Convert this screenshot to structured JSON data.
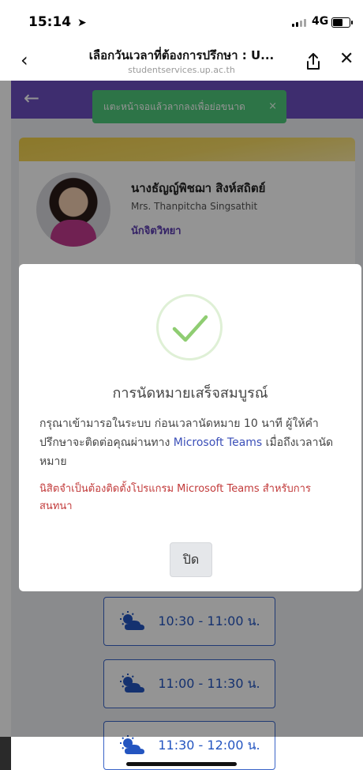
{
  "status_bar": {
    "time": "15:14",
    "location_arrow": "➤",
    "network": "4G"
  },
  "browser": {
    "title": "เลือกวันเวลาที่ต้องการปรึกษา : U...",
    "url": "studentservices.up.ac.th",
    "back_icon": "‹",
    "close_icon": "✕"
  },
  "toast": {
    "text": "แตะหน้าจอแล้วลากลงเพื่อย่อขนาด",
    "close": "×"
  },
  "counselor": {
    "name_th": "นางธัญญ์พิชฌา สิงห์สถิตย์",
    "name_en": "Mrs. Thanpitcha Singsathit",
    "role": "นักจิตวิทยา"
  },
  "time_slots": [
    {
      "label": "10:30 - 11:00 น."
    },
    {
      "label": "11:00 - 11:30 น."
    },
    {
      "label": "11:30 - 12:00 น."
    }
  ],
  "modal": {
    "title": "การนัดหมายเสร็จสมบูรณ์",
    "message_part1": "กรุณาเข้ามารอในระบบ ก่อนเวลานัดหมาย 10 นาที ผู้ให้คำปรึกษาจะติดต่อคุณผ่านทาง ",
    "message_link": "Microsoft Teams",
    "message_part2": " เมื่อถึงเวลานัดหมาย",
    "warning": "นิสิตจำเป็นต้องติดตั้งโปรแกรม Microsoft Teams สำหรับการสนทนา",
    "close_button": "ปิด"
  },
  "colors": {
    "header": "#6b4fbf",
    "toast": "#4fc97a",
    "accent_blue": "#2455c0",
    "warning": "#c23a3a"
  }
}
